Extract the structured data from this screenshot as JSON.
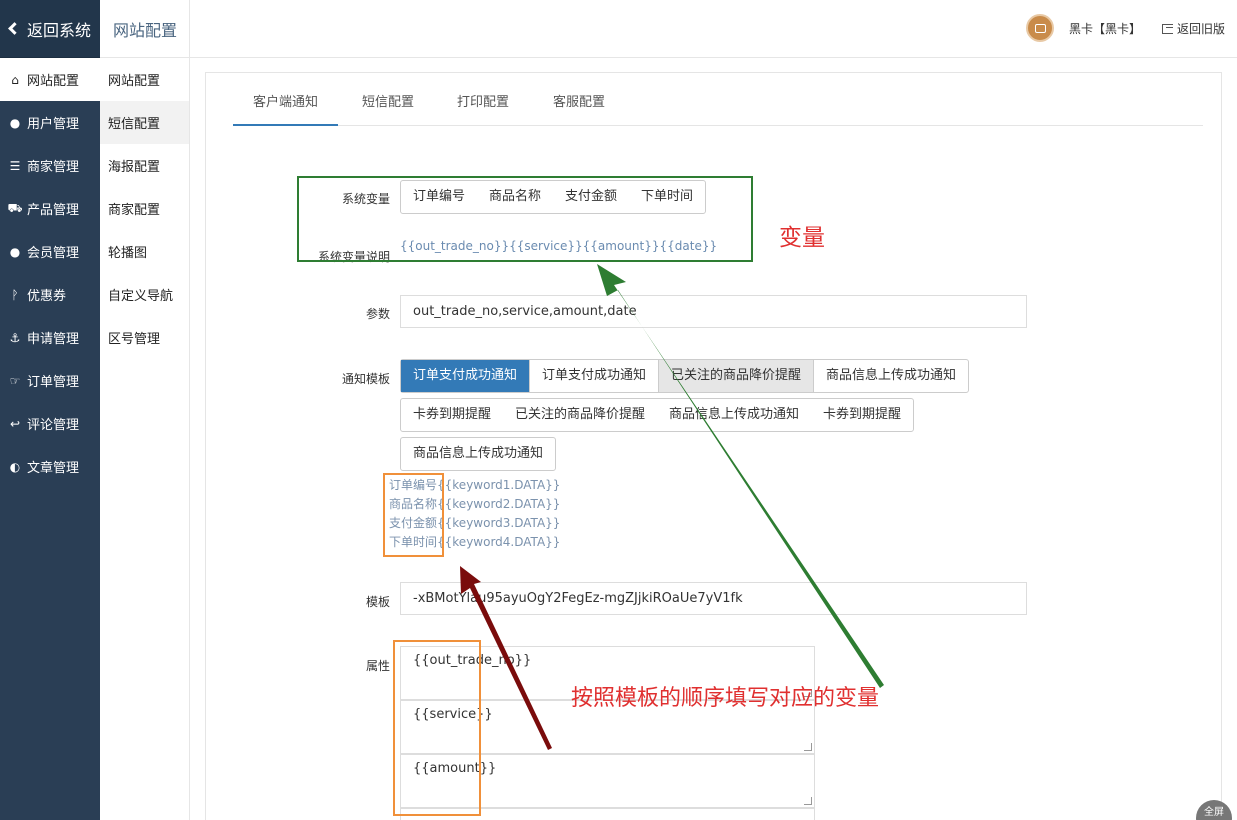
{
  "sidebar": {
    "back_label": "返回系统",
    "items": [
      {
        "label": "网站配置",
        "icon": "home-icon"
      },
      {
        "label": "用户管理",
        "icon": "user-icon"
      },
      {
        "label": "商家管理",
        "icon": "server-icon"
      },
      {
        "label": "产品管理",
        "icon": "cart-icon"
      },
      {
        "label": "会员管理",
        "icon": "group-icon"
      },
      {
        "label": "优惠券",
        "icon": "branch-icon"
      },
      {
        "label": "申请管理",
        "icon": "anchor-icon"
      },
      {
        "label": "订单管理",
        "icon": "hand-icon"
      },
      {
        "label": "评论管理",
        "icon": "reply-icon"
      },
      {
        "label": "文章管理",
        "icon": "half-circle-icon"
      }
    ]
  },
  "submenu": {
    "title": "网站配置",
    "items": [
      "网站配置",
      "短信配置",
      "海报配置",
      "商家配置",
      "轮播图",
      "自定义导航",
      "区号管理"
    ]
  },
  "header": {
    "user": "黑卡【黑卡】",
    "old_version": "返回旧版"
  },
  "tabs": [
    "客户端通知",
    "短信配置",
    "打印配置",
    "客服配置"
  ],
  "form": {
    "sys_var_label": "系统变量",
    "sys_vars": [
      "订单编号",
      "商品名称",
      "支付金额",
      "下单时间"
    ],
    "sys_var_desc_label": "系统变量说明",
    "sys_var_desc": "{{out_trade_no}}{{service}}{{amount}}{{date}}",
    "params_label": "参数",
    "params_value": "out_trade_no,service,amount,date",
    "template_notify_label": "通知模板",
    "templates_row1": [
      "订单支付成功通知",
      "订单支付成功通知",
      "已关注的商品降价提醒",
      "商品信息上传成功通知"
    ],
    "templates_row2": [
      "卡券到期提醒",
      "已关注的商品降价提醒",
      "商品信息上传成功通知",
      "卡券到期提醒"
    ],
    "templates_row3": [
      "商品信息上传成功通知"
    ],
    "keywords": [
      {
        "name": "订单编号",
        "key": "{{keyword1.DATA}}"
      },
      {
        "name": "商品名称",
        "key": "{{keyword2.DATA}}"
      },
      {
        "name": "支付金额",
        "key": "{{keyword3.DATA}}"
      },
      {
        "name": "下单时间",
        "key": "{{keyword4.DATA}}"
      }
    ],
    "template_label": "模板",
    "template_value": "-xBMotYlau95ayuOgY2FegEz-mgZJjkiROaUe7yV1fk",
    "attr_label": "属性",
    "attrs": [
      "{{out_trade_no}}",
      "{{service}}",
      "{{amount}}"
    ]
  },
  "annotations": {
    "var_note": "变量",
    "order_note": "按照模板的顺序填写对应的变量",
    "green": "#2e7d32",
    "orange": "#f0903a",
    "darkred": "#7a0c0c"
  },
  "fullscreen_label": "全屏"
}
